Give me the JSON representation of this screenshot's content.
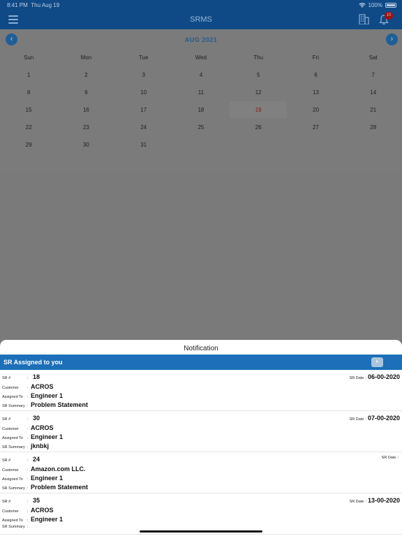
{
  "status_bar": {
    "time": "8:41 PM",
    "date": "Thu Aug 19",
    "battery": "100%"
  },
  "nav": {
    "title": "SRMS",
    "notification_count": "10"
  },
  "calendar": {
    "month_label": "AUG 2021",
    "weekdays": [
      "Sun",
      "Mon",
      "Tue",
      "Wed",
      "Thu",
      "Fri",
      "Sat"
    ],
    "weeks": [
      [
        "1",
        "2",
        "3",
        "4",
        "5",
        "6",
        "7"
      ],
      [
        "8",
        "9",
        "10",
        "11",
        "12",
        "13",
        "14"
      ],
      [
        "15",
        "16",
        "17",
        "18",
        "19",
        "20",
        "21"
      ],
      [
        "22",
        "23",
        "24",
        "25",
        "26",
        "27",
        "28"
      ],
      [
        "29",
        "30",
        "31",
        "",
        "",
        "",
        ""
      ]
    ],
    "today": "19",
    "today_color": "#8a1414"
  },
  "sheet": {
    "title": "Notification",
    "section_title": "SR Assigned to you",
    "section_count": "6",
    "labels": {
      "sr": "SR #",
      "customer": "Customer",
      "assigned": "Assigned To",
      "summary": "SR Summary",
      "date": "SR Date",
      "sep": ":"
    },
    "items": [
      {
        "sr": "18",
        "date": "06-00-2020",
        "customer": "ACROS",
        "assigned": "Engineer 1",
        "summary": "Problem Statement"
      },
      {
        "sr": "30",
        "date": "07-00-2020",
        "customer": "ACROS",
        "assigned": "Engineer 1",
        "summary": "jknbkj"
      },
      {
        "sr": "24",
        "date": "",
        "customer": "Amazon.com LLC.",
        "assigned": "Engineer 1",
        "summary": "Problem Statement"
      },
      {
        "sr": "35",
        "date": "13-00-2020",
        "customer": "ACROS",
        "assigned": "Engineer 1",
        "summary": ""
      }
    ]
  },
  "colors": {
    "accent": "#1c6fb8",
    "nav": "#0f4a86"
  }
}
